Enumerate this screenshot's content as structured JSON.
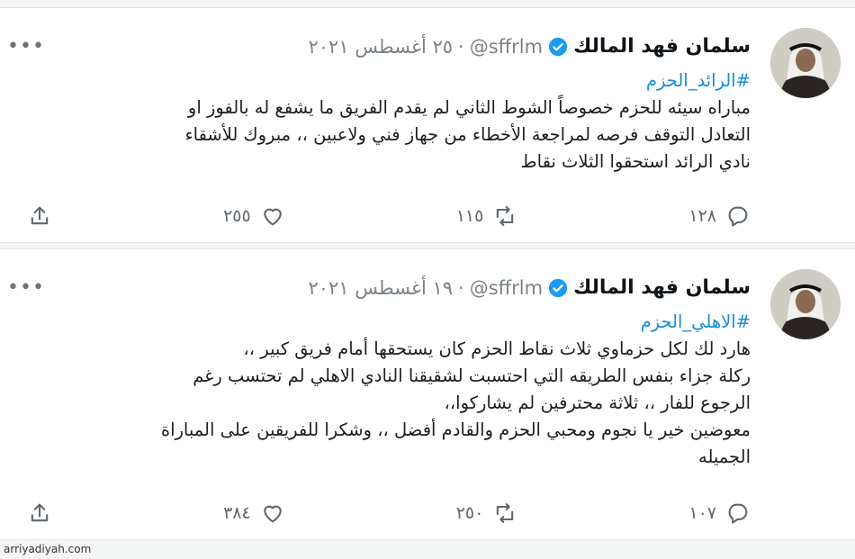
{
  "tweets": [
    {
      "author_name": "سلمان فهد المالك",
      "handle": "@sffrlm",
      "separator": "·",
      "date": "٢٥ أغسطس ٢٠٢١",
      "more": "•••",
      "hashtag": "#الرائد_الحزم",
      "lines": [
        "مباراه سيئه للحزم خصوصاً الشوط الثاني لم يقدم الفريق ما يشفع له بالفوز او",
        "التعادل التوقف فرصه لمراجعة الأخطاء من جهاز فني ولاعبين ،، مبروك للأشقاء",
        "نادي الرائد استحقوا الثلاث نقاط"
      ],
      "replies": "١٢٨",
      "retweets": "١١٥",
      "likes": "٢٥٥"
    },
    {
      "author_name": "سلمان فهد المالك",
      "handle": "@sffrlm",
      "separator": "·",
      "date": "١٩ أغسطس ٢٠٢١",
      "more": "•••",
      "hashtag": "#الاهلي_الحزم",
      "lines": [
        "هارد لك لكل حزماوي ثلاث نقاط الحزم كان يستحقها أمام فريق كبير ،،",
        "ركلة جزاء بنفس الطريقه التي احتسبت لشقيقنا النادي الاهلي لم تحتسب رغم",
        "الرجوع للفار ،، ثلاثة محترفين لم يشاركوا،،",
        "معوضين خير يا نجوم ومحبي الحزم والقادم أفضل ،، وشكرا للفريقين على المباراة",
        "الجميله"
      ],
      "replies": "١٠٧",
      "retweets": "٢٥٠",
      "likes": "٣٨٤"
    }
  ],
  "watermark": "arriyadiyah.com",
  "colors": {
    "link": "#1a8cd8",
    "verified": "#1d9bf0",
    "muted": "#7a8288"
  }
}
